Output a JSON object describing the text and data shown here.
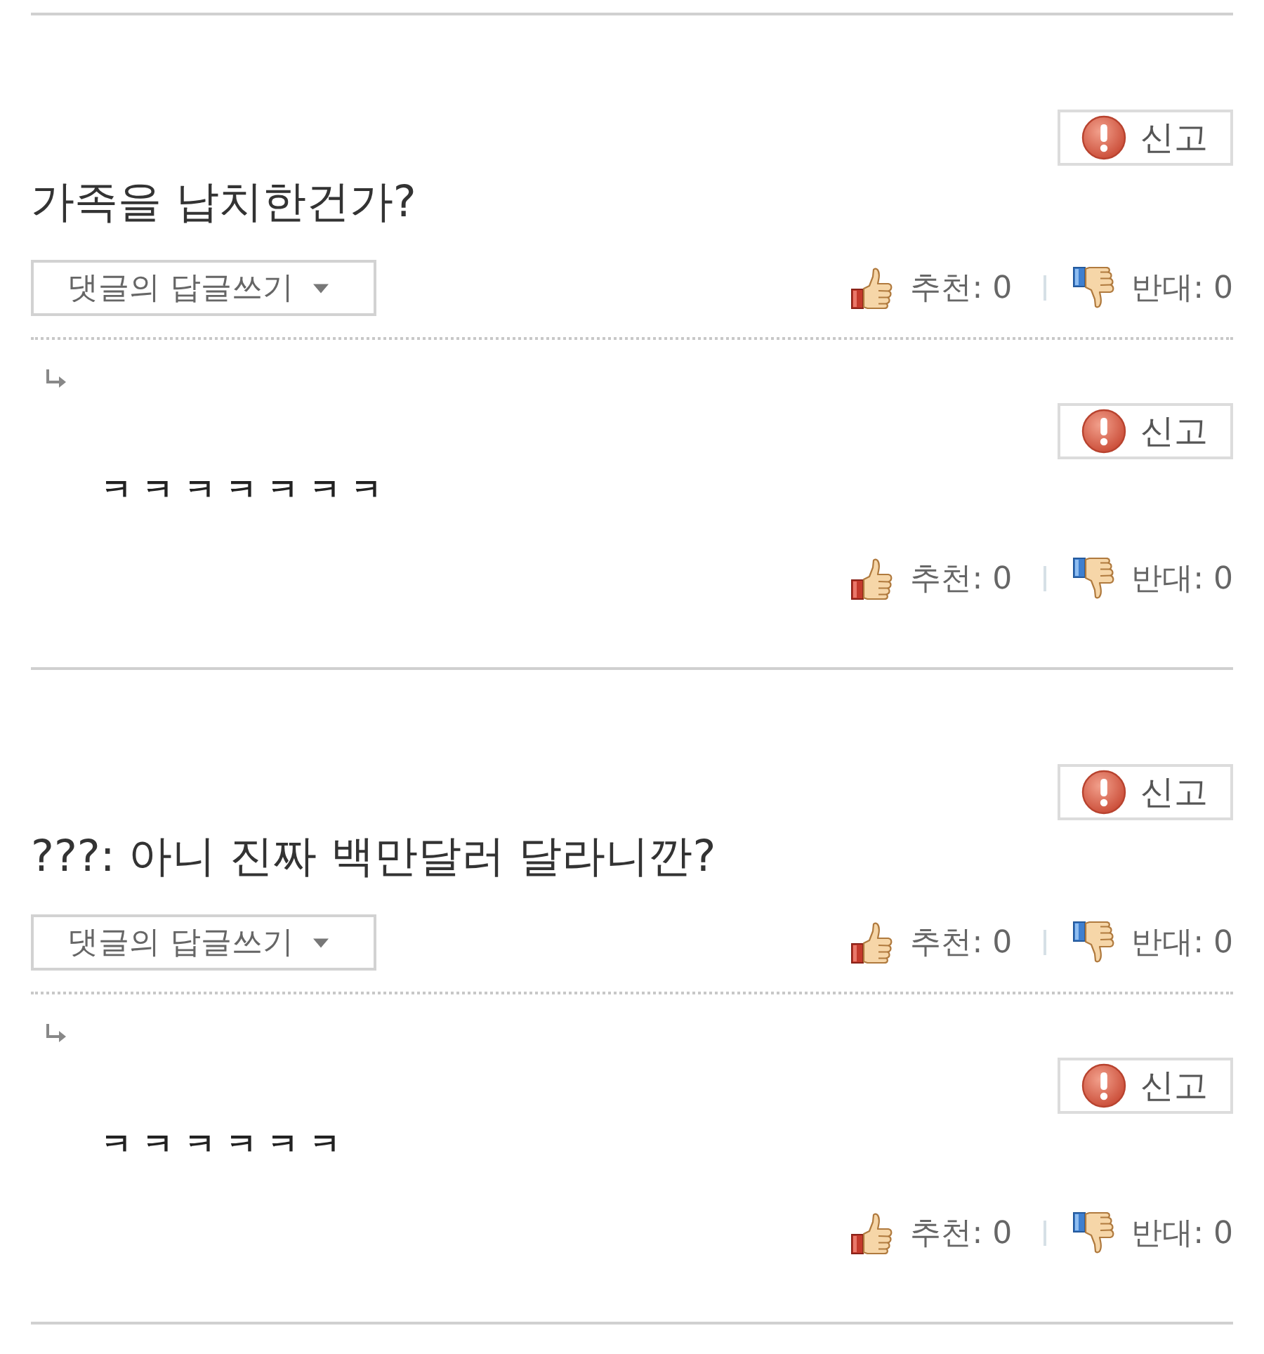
{
  "comments": [
    {
      "report_button": "신고",
      "text": "가족을 납치한건가?",
      "reply_dropdown": "댓글의 답글쓰기",
      "votes": {
        "up": "추천: 0",
        "down": "반대: 0"
      },
      "replies": [
        {
          "report_button": "신고",
          "text": "ㅋ ㅋ ㅋ ㅋ ㅋ ㅋ ㅋ",
          "votes": {
            "up": "추천: 0",
            "down": "반대: 0"
          }
        }
      ]
    },
    {
      "report_button": "신고",
      "text": "???: 아니 진짜 백만달러 달라니깐?",
      "reply_dropdown": "댓글의 답글쓰기",
      "votes": {
        "up": "추천: 0",
        "down": "반대: 0"
      },
      "replies": [
        {
          "report_button": "신고",
          "text": "ㅋ ㅋ ㅋ ㅋ ㅋ ㅋ",
          "votes": {
            "up": "추천: 0",
            "down": "반대: 0"
          }
        }
      ]
    }
  ]
}
